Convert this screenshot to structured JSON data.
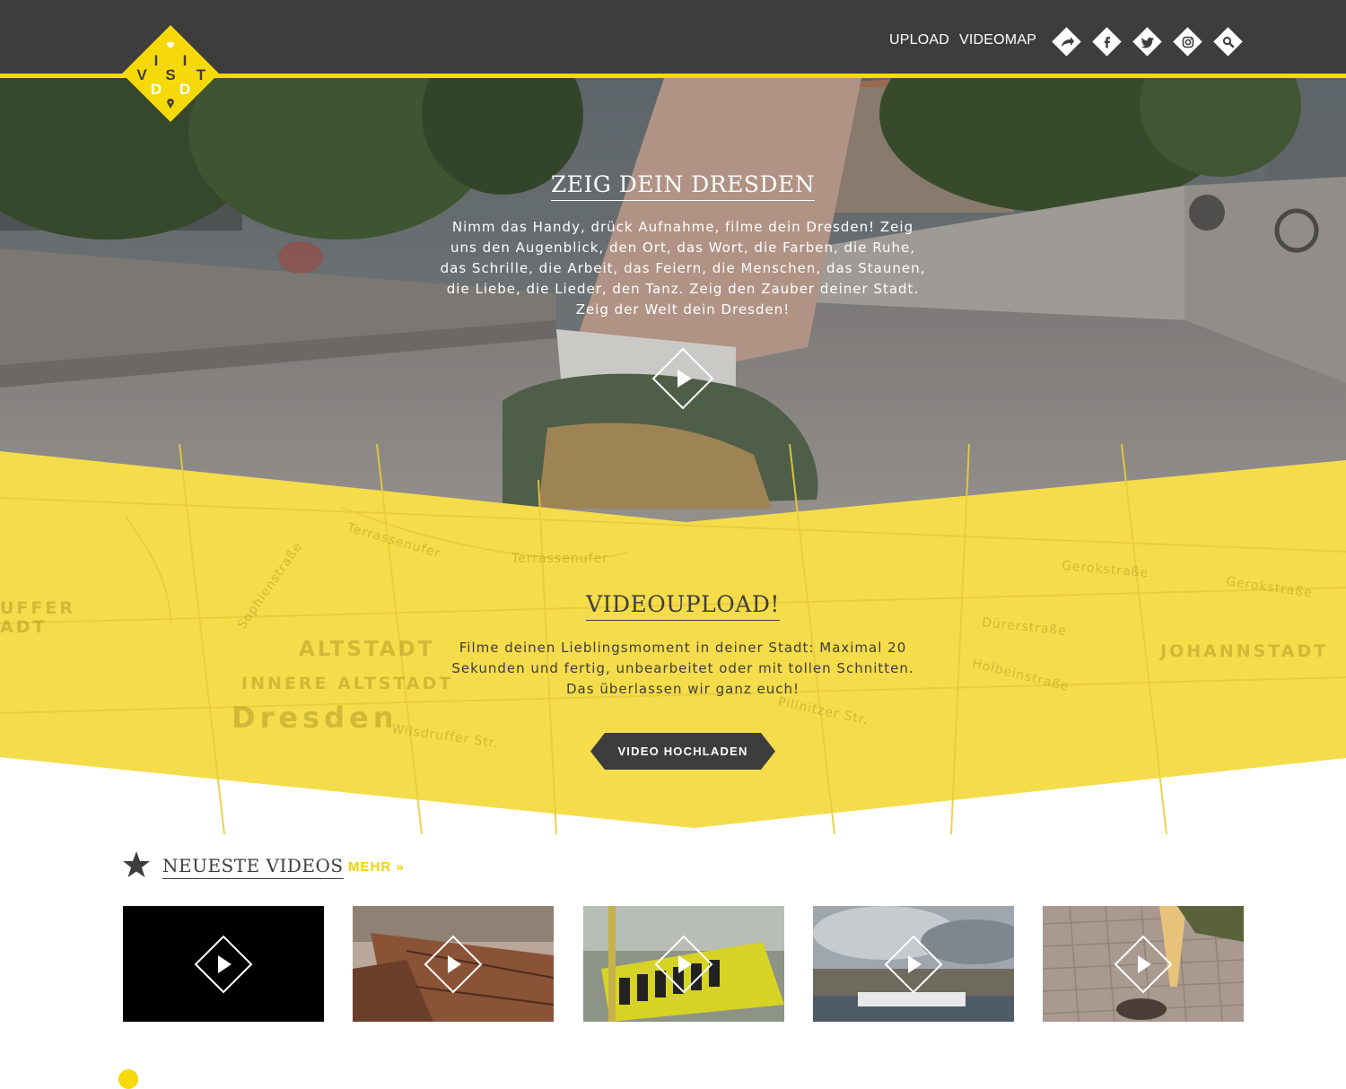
{
  "brand": {
    "logo_letters": [
      "V",
      "I",
      "S",
      "I",
      "T",
      "D",
      "D"
    ],
    "accent_color": "#f5d90a",
    "dark_color": "#3d3d3d"
  },
  "nav": {
    "upload_label": "UPLOAD",
    "videomap_label": "VIDEOMAP",
    "social_icons": [
      "share-icon",
      "facebook-icon",
      "twitter-icon",
      "instagram-icon",
      "search-icon"
    ]
  },
  "hero": {
    "title": "ZEIG DEIN DRESDEN",
    "text": "Nimm das Handy, drück Aufnahme, filme dein Dresden! Zeig uns den Augenblick, den Ort, das Wort, die Farben, die Ruhe, das Schrille, die Arbeit, das Feiern, die Menschen, das Staunen, die Liebe, die Lieder, den Tanz. Zeig den Zauber deiner Stadt. Zeig der Welt dein Dresden!",
    "play_icon": "play-icon"
  },
  "upload": {
    "title": "VIDEOUPLOAD!",
    "text": "Filme deinen Lieblingsmoment in deiner Stadt: Maximal 20 Sekunden und fertig, unbearbeitet oder mit tollen Schnitten. Das überlassen wir ganz euch!",
    "button_label": "VIDEO HOCHLADEN",
    "map_labels": {
      "altstadt": "ALTSTADT",
      "innere_altstadt": "INNERE ALTSTADT",
      "dresden": "Dresden",
      "johannstadt": "JOHANNSTADT",
      "uffer": "UFFER",
      "adt": "ADT",
      "terrassenufer": "Terrassenufer",
      "gerokstrasse": "Gerokstraße",
      "durerstrasse": "Dürerstraße",
      "holbeinstrasse": "Holbeinstraße",
      "wilsdruffer": "Wilsdruffer Str.",
      "pillnitzer": "Pillnitzer Str.",
      "sophienstrasse": "Sophienstraße"
    }
  },
  "latest": {
    "title": "NEUESTE VIDEOS",
    "more_label": "MEHR »",
    "thumbnails": [
      {
        "name": "video-thumb-black"
      },
      {
        "name": "video-thumb-zwinger"
      },
      {
        "name": "video-thumb-rundgang"
      },
      {
        "name": "video-thumb-elbe"
      },
      {
        "name": "video-thumb-pavement"
      }
    ]
  }
}
